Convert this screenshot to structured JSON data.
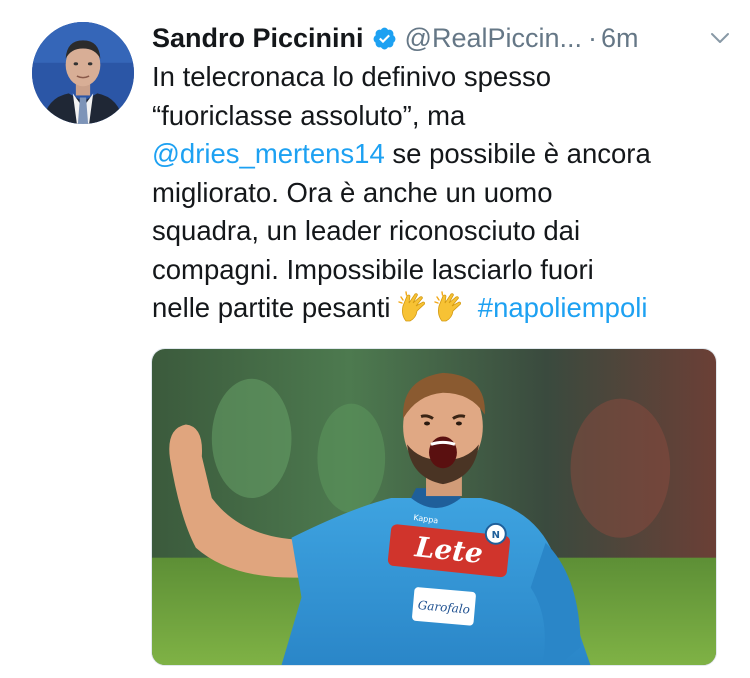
{
  "tweet": {
    "author": {
      "display_name": "Sandro Piccinini",
      "handle": "@RealPiccin...",
      "verified_icon": "verified-badge-icon",
      "avatar": "profile-photo"
    },
    "separator": "·",
    "timestamp": "6m",
    "menu_icon": "chevron-down-icon",
    "text_lines": [
      {
        "text": "In telecronaca lo definivo spesso"
      },
      {
        "text": "“fuoriclasse assoluto”, ma"
      },
      {
        "mention": "@dries_mertens14",
        "text": " se possibile è ancora"
      },
      {
        "text": "migliorato. Ora è anche un uomo"
      },
      {
        "text": "squadra, un leader riconosciuto dai"
      },
      {
        "text": "compagni. Impossibile lasciarlo fuori"
      },
      {
        "text": "nelle partite pesanti ",
        "emoji": "clapping-hands-icon",
        "hashtag": "#napoliempoli"
      }
    ],
    "media": {
      "description_icon": "photo-football-player-celebrating",
      "jersey_sponsor": "Lete",
      "jersey_second_sponsor": "Garofalo",
      "jersey_brand": "Kappa"
    },
    "colors": {
      "link": "#1da1f2",
      "text": "#14171a",
      "secondary": "#657786"
    }
  }
}
